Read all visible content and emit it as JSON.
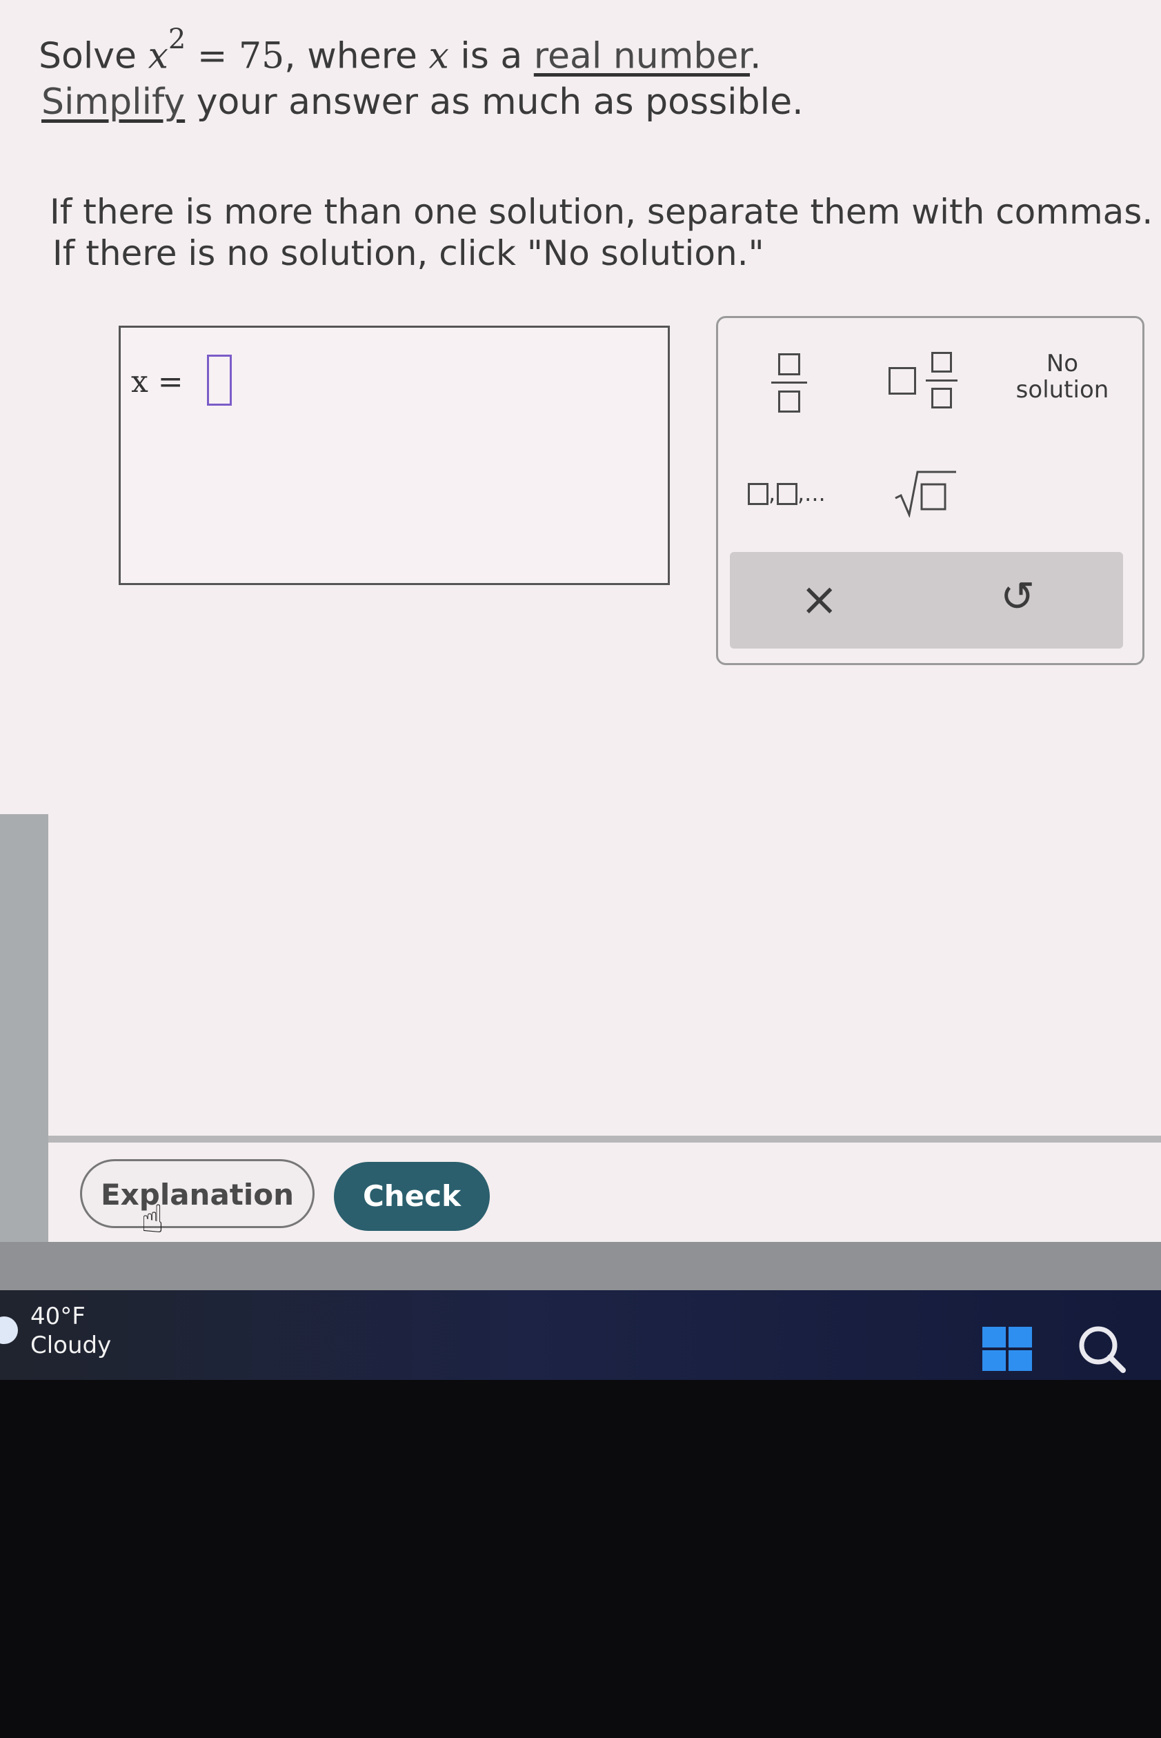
{
  "question": {
    "line1_prefix": "Solve ",
    "var": "x",
    "exponent": "2",
    "eq_rest": " = 75",
    "line1_mid": ", where ",
    "var2": "x",
    "line1_mid2": " is a ",
    "link1": "real number",
    "line1_end": ".",
    "link2": "Simplify",
    "line2_rest": " your answer as much as possible.",
    "line3": "If there is more than one solution, separate them with commas.",
    "line4": "If there is no solution, click \"No solution.\""
  },
  "answer": {
    "label": "x =",
    "value": ""
  },
  "keypad": {
    "fraction_icon": "fraction-icon",
    "mixed_number_icon": "mixed-number-icon",
    "list_label": ",",
    "list_ellipsis": ",...",
    "sqrt_icon": "square-root-icon",
    "no_solution_line1": "No",
    "no_solution_line2": "solution",
    "clear_symbol": "×",
    "undo_symbol": "↺"
  },
  "buttons": {
    "explanation": "Explanation",
    "check": "Check"
  },
  "taskbar": {
    "temperature": "40°F",
    "condition": "Cloudy",
    "start_icon": "windows-start-icon",
    "search_icon": "search-icon"
  },
  "colors": {
    "check_button": "#2b5f6d",
    "input_cursor": "#7b5cc8",
    "start_blue": "#2f8ff0"
  }
}
